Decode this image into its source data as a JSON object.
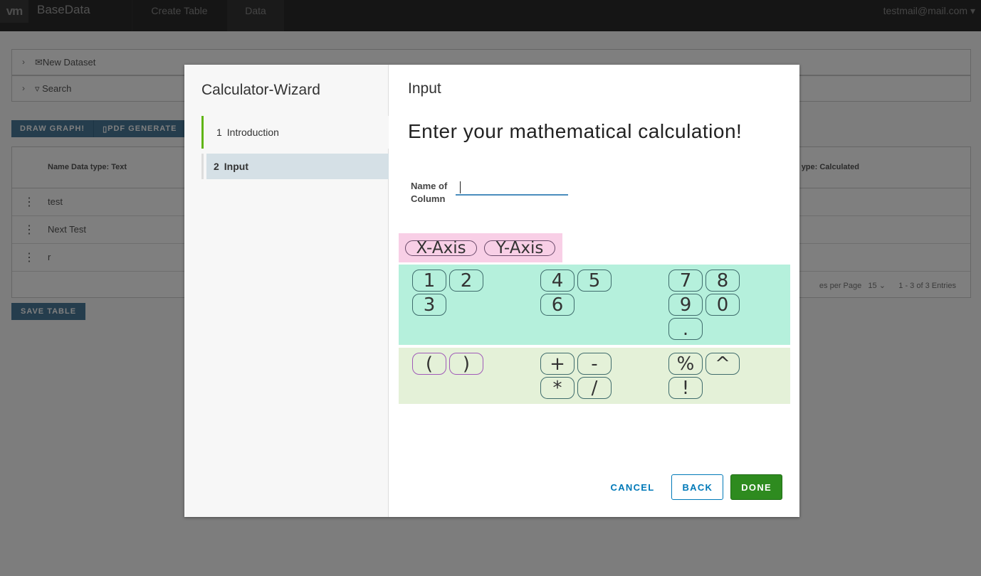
{
  "header": {
    "logo": "vm",
    "brand": "BaseData",
    "nav": [
      "Create Table",
      "Data"
    ],
    "user": "testmail@mail.com"
  },
  "background": {
    "panels": [
      "New Dataset",
      "Search"
    ],
    "buttons": [
      "DRAW GRAPH!",
      "PDF GENERATE"
    ],
    "columns": [
      "Name Data type: Text",
      "ype: Calculated"
    ],
    "rows": [
      "test",
      "Next Test",
      "r"
    ],
    "pager": {
      "per_page_label": "es per Page",
      "per_page": "15",
      "range": "1 - 3 of 3 Entries"
    },
    "save_label": "SAVE TABLE"
  },
  "wizard": {
    "title": "Calculator-Wizard",
    "steps": [
      {
        "num": "1",
        "label": "Introduction"
      },
      {
        "num": "2",
        "label": "Input"
      }
    ],
    "page_title": "Input",
    "heading": "Enter your mathematical calculation!",
    "name_label": "Name of Column",
    "name_value": "",
    "axis_buttons": [
      "X-Axis",
      "Y-Axis"
    ],
    "number_groups": [
      [
        "1",
        "2",
        "3"
      ],
      [
        "4",
        "5",
        "6"
      ],
      [
        "7",
        "8",
        "9",
        "0",
        "."
      ]
    ],
    "operator_groups": [
      [
        "(",
        ")"
      ],
      [
        "+",
        "-",
        "*",
        "/"
      ],
      [
        "%",
        "^",
        "!"
      ]
    ],
    "cancel": "CANCEL",
    "back": "BACK",
    "done": "DONE"
  }
}
